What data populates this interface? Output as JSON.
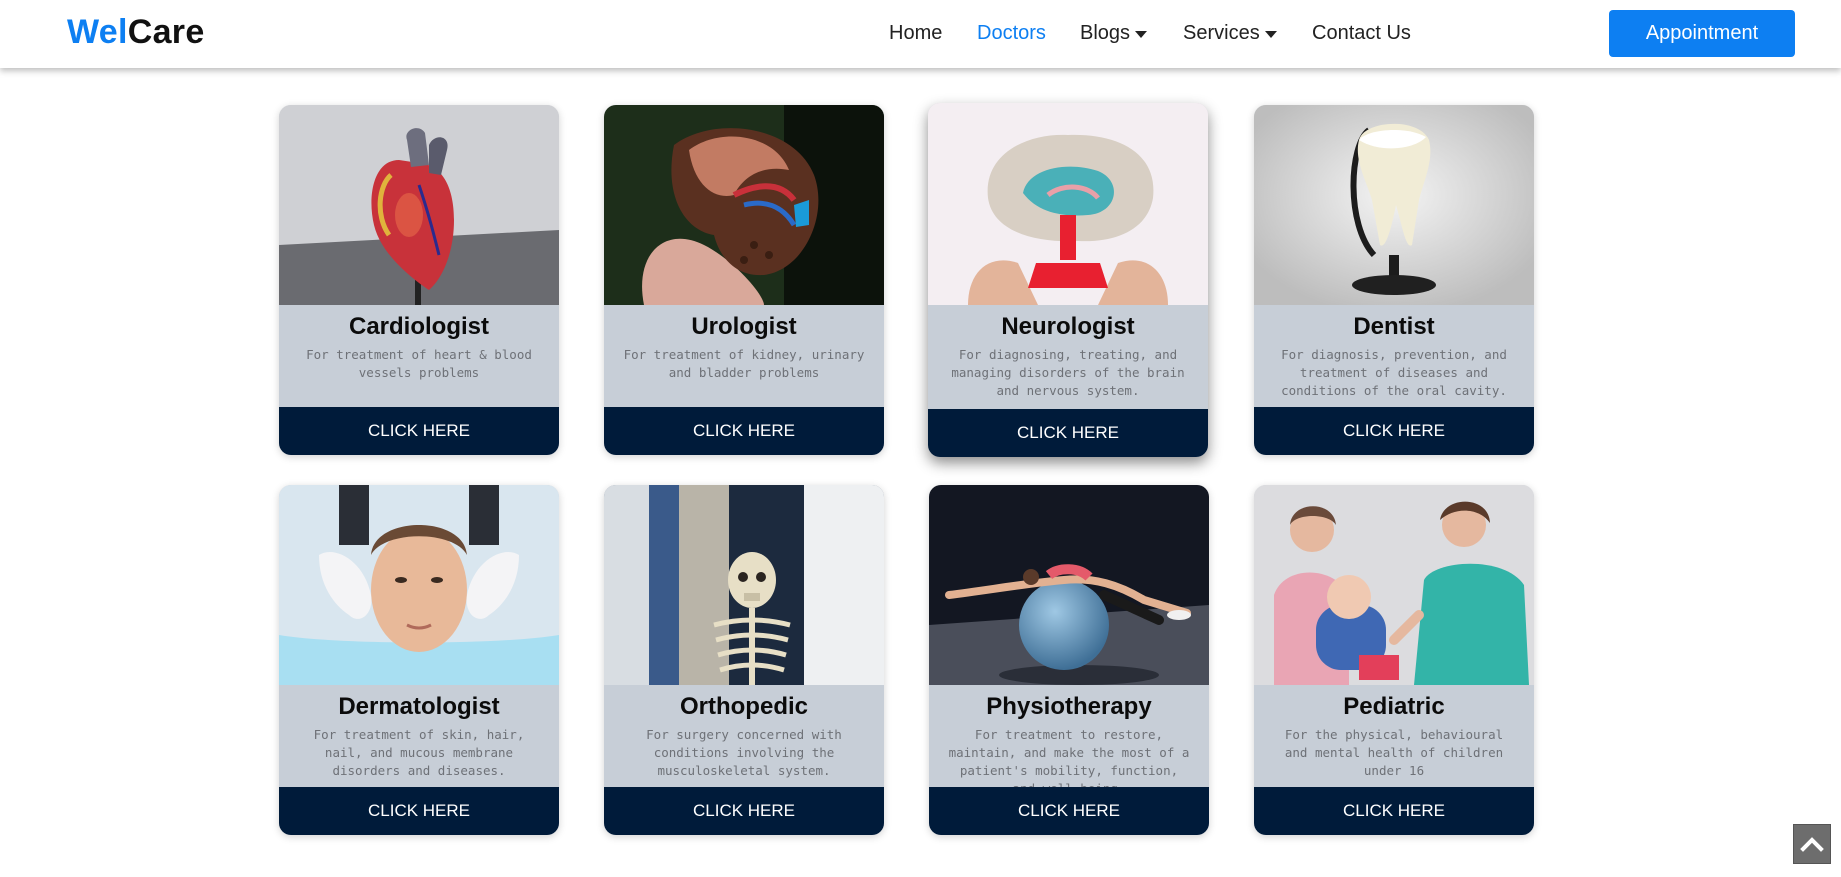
{
  "brand": {
    "part1": "Wel",
    "part2": "Care",
    "color_primary": "#0d7ff2",
    "color_secondary": "#111111"
  },
  "nav": {
    "items": [
      {
        "label": "Home",
        "active": false,
        "dropdown": false
      },
      {
        "label": "Doctors",
        "active": true,
        "dropdown": false
      },
      {
        "label": "Blogs",
        "active": false,
        "dropdown": true
      },
      {
        "label": "Services",
        "active": false,
        "dropdown": true
      },
      {
        "label": "Contact Us",
        "active": false,
        "dropdown": false
      }
    ],
    "cta_label": "Appointment"
  },
  "cards": [
    {
      "title": "Cardiologist",
      "description": "For treatment of heart & blood vessels problems",
      "button": "CLICK HERE",
      "image": "heart-model-image"
    },
    {
      "title": "Urologist",
      "description": "For treatment of kidney, urinary and bladder problems",
      "button": "CLICK HERE",
      "image": "kidney-model-image"
    },
    {
      "title": "Neurologist",
      "description": "For diagnosing, treating, and managing disorders of the brain and nervous system.",
      "button": "CLICK HERE",
      "image": "brain-model-image"
    },
    {
      "title": "Dentist",
      "description": "For diagnosis, prevention, and treatment of diseases and conditions of the oral cavity.",
      "button": "CLICK HERE",
      "image": "tooth-model-image"
    },
    {
      "title": "Dermatologist",
      "description": "For treatment of skin, hair, nail, and mucous membrane disorders and diseases.",
      "button": "CLICK HERE",
      "image": "skin-care-image"
    },
    {
      "title": "Orthopedic",
      "description": "For surgery concerned with conditions involving the musculoskeletal system.",
      "button": "CLICK HERE",
      "image": "skeleton-image"
    },
    {
      "title": "Physiotherapy",
      "description": "For treatment to restore, maintain, and make the most of a patient's mobility, function, and well-being.",
      "button": "CLICK HERE",
      "image": "exercise-ball-image"
    },
    {
      "title": "Pediatric",
      "description": "For the physical, behavioural and mental health of children under 16",
      "button": "CLICK HERE",
      "image": "child-checkup-image"
    }
  ],
  "colors": {
    "card_body": "#c7ced7",
    "card_button": "#001b3a",
    "accent": "#0d7ff2"
  },
  "scroll_top_icon": "chevron-up-icon"
}
